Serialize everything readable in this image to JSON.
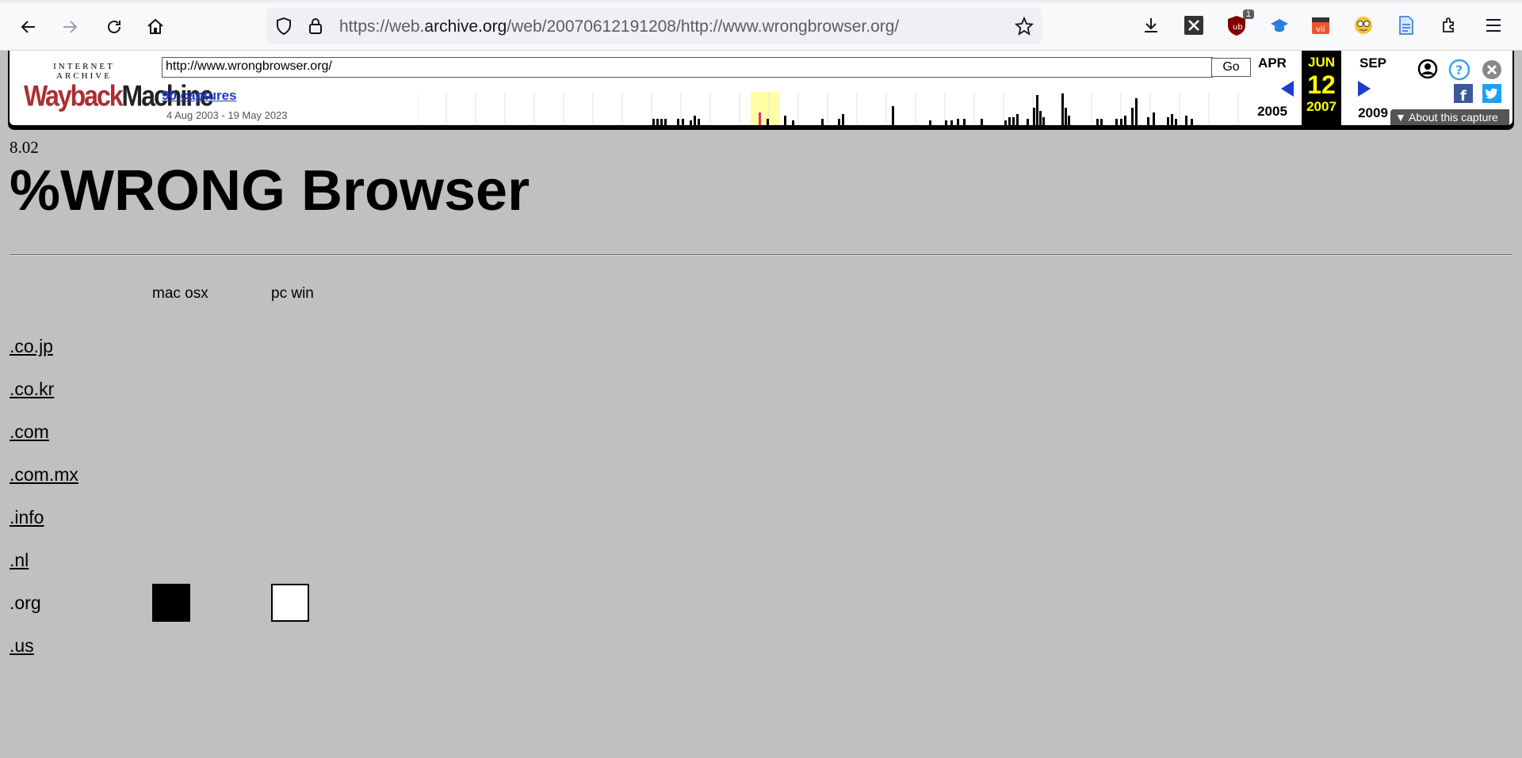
{
  "browser": {
    "url_prefix": "https://web.",
    "url_domain": "archive.org",
    "url_suffix": "/web/20070612191208/http://www.wrongbrowser.org/",
    "ublock_badge": "1"
  },
  "wayback": {
    "logo_top": "INTERNET ARCHIVE",
    "logo_way": "Wayback",
    "logo_machine": "Machine",
    "url_value": "http://www.wrongbrowser.org/",
    "go_label": "Go",
    "captures_label": "90 captures",
    "date_range": "4 Aug 2003 - 19 May 2023",
    "prev_month": "APR",
    "prev_year": "2005",
    "current_month": "JUN",
    "current_day": "12",
    "current_year": "2007",
    "next_month": "SEP",
    "next_year": "2009",
    "about_label": "About this capture"
  },
  "page": {
    "version": "8.02",
    "title": "%WRONG Browser",
    "columns": [
      "mac osx",
      "pc win"
    ],
    "rows": [
      {
        "tld": ".co.jp",
        "link": true
      },
      {
        "tld": ".co.kr",
        "link": true
      },
      {
        "tld": ".com",
        "link": true
      },
      {
        "tld": ".com.mx",
        "link": true
      },
      {
        "tld": ".info",
        "link": true
      },
      {
        "tld": ".nl",
        "link": true
      },
      {
        "tld": ".org",
        "link": false,
        "mac": "filled",
        "pc": "empty"
      },
      {
        "tld": ".us",
        "link": true
      }
    ]
  }
}
